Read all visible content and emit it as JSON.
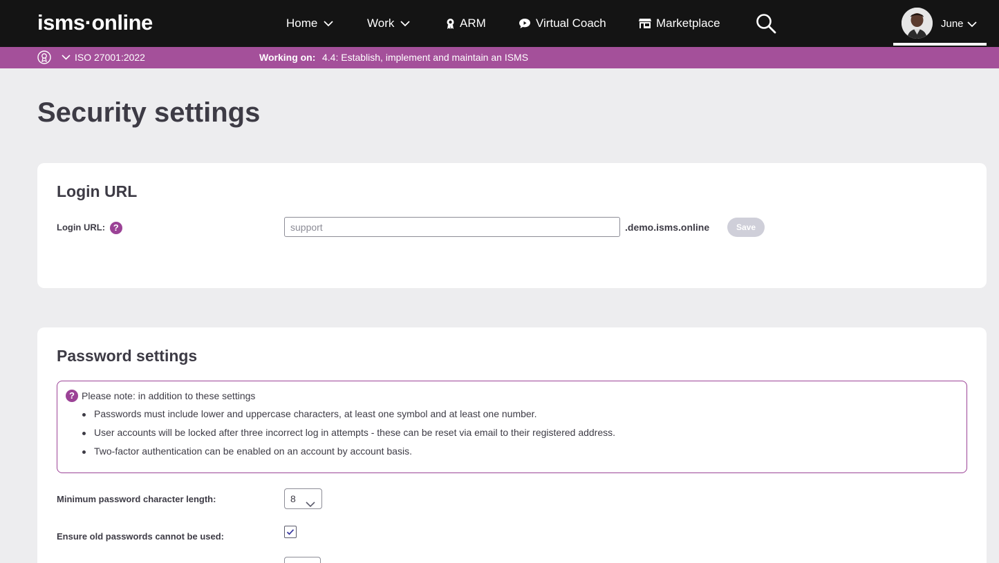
{
  "nav": {
    "logo": "isms·online",
    "items": [
      {
        "label": "Home"
      },
      {
        "label": "Work"
      },
      {
        "label": "ARM"
      },
      {
        "label": "Virtual Coach"
      },
      {
        "label": "Marketplace"
      }
    ],
    "user_name": "June"
  },
  "subbar": {
    "standard": "ISO 27001:2022",
    "working_label": "Working on:",
    "task": "4.4: Establish, implement and maintain an ISMS"
  },
  "page_title": "Security settings",
  "login": {
    "heading": "Login URL",
    "field_label": "Login URL:",
    "placeholder": "support",
    "domain_suffix": ".demo.isms.online",
    "save_label": "Save"
  },
  "password": {
    "heading": "Password settings",
    "note_title": "Please note: in addition to these settings",
    "note_items": [
      "Passwords must include lower and uppercase characters, at least one symbol and at least one number.",
      "User accounts will be locked after three incorrect log in attempts - these can be reset via email to their registered address.",
      "Two-factor authentication can be enabled on an account by account basis."
    ],
    "min_length_label": "Minimum password character length:",
    "min_length_value": "8",
    "old_passwords_label": "Ensure old passwords cannot be used:",
    "old_passwords_checked": true
  },
  "colors": {
    "accent": "#a4509a",
    "nav_bg": "#141414",
    "page_bg": "#ededef",
    "text": "#3d3b45"
  }
}
